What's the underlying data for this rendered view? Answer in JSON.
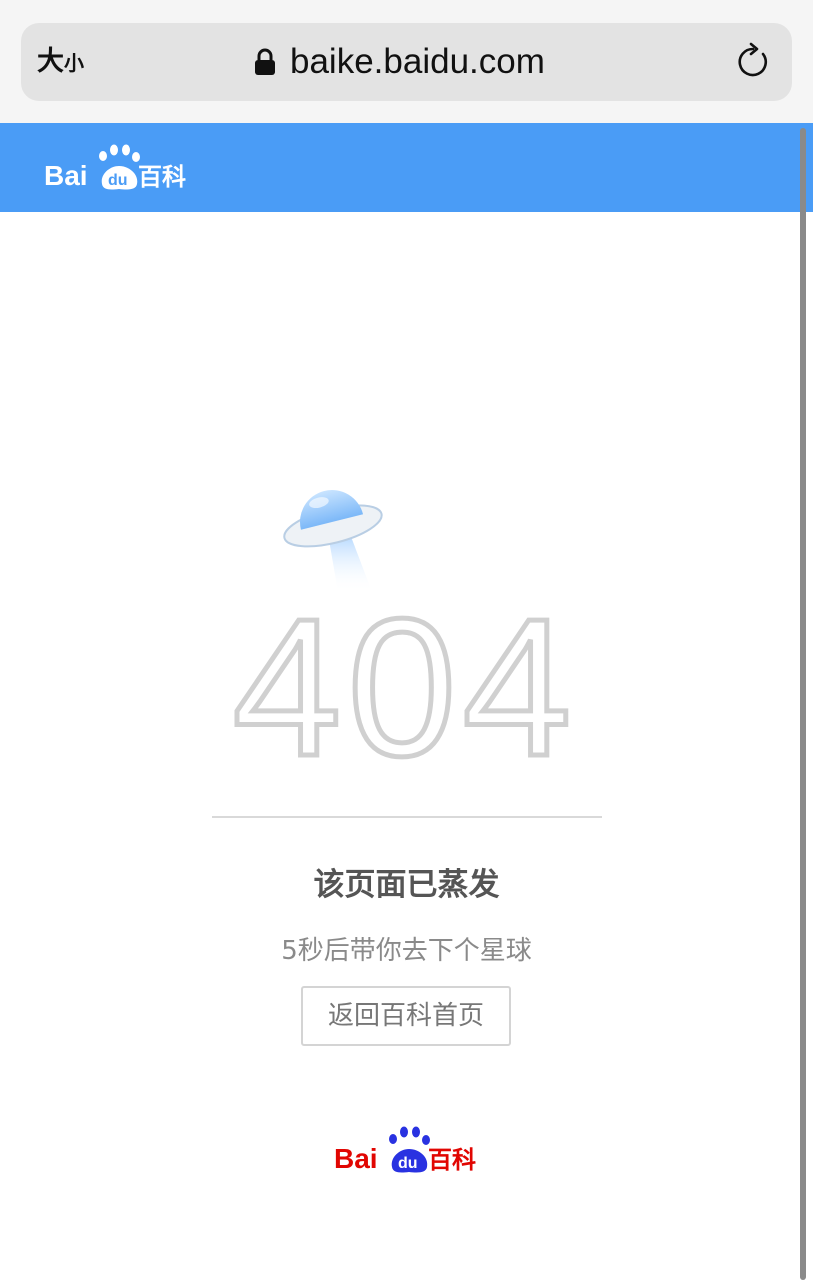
{
  "browser": {
    "text_size_big": "大",
    "text_size_small": "小",
    "url": "baike.baidu.com",
    "lock_icon": "lock-icon",
    "reload_icon": "reload-icon"
  },
  "header": {
    "logo_text_bai": "Bai",
    "logo_text_du": "du",
    "logo_text_baike": "百科"
  },
  "error": {
    "code": "404",
    "title": "该页面已蒸发",
    "subtitle": "5秒后带你去下个星球",
    "button_label": "返回百科首页"
  },
  "footer": {
    "logo_text_bai": "Bai",
    "logo_text_du": "du",
    "logo_text_baike": "百科"
  },
  "colors": {
    "header_bg": "#4a9cf6",
    "brand_red": "#e10602",
    "brand_blue": "#2932e1"
  }
}
